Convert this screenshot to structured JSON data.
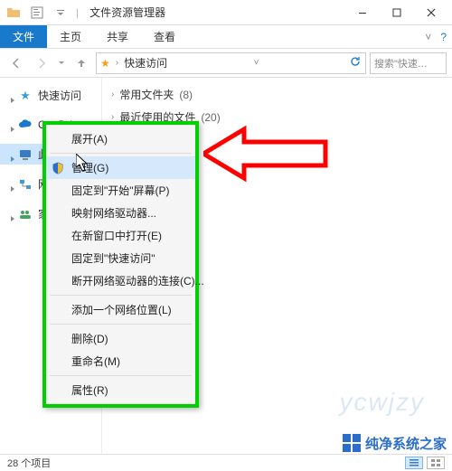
{
  "titlebar": {
    "appTitle": "文件资源管理器",
    "sep": "|"
  },
  "ribbon": {
    "file": "文件",
    "home": "主页",
    "share": "共享",
    "view": "查看",
    "help": "?"
  },
  "addrbar": {
    "crumb": "快速访问",
    "searchPlaceholder": "搜索\"快速…"
  },
  "sidebar": {
    "quickAccess": "快速访问",
    "onedrive": "OneDrive",
    "thisPC": "此电脑",
    "networkShort": "网",
    "homeShort": "家"
  },
  "content": {
    "frequentFolders": "常用文件夹",
    "frequentCount": "(8)",
    "recentFiles": "最近使用的文件",
    "recentCount": "(20)"
  },
  "contextMenu": {
    "expand": "展开(A)",
    "manage": "管理(G)",
    "pinStart": "固定到\"开始\"屏幕(P)",
    "mapDrive": "映射网络驱动器...",
    "openNew": "在新窗口中打开(E)",
    "pinQuick": "固定到\"快速访问\"",
    "disconnect": "断开网络驱动器的连接(C)...",
    "addNetLoc": "添加一个网络位置(L)",
    "delete": "删除(D)",
    "rename": "重命名(M)",
    "properties": "属性(R)"
  },
  "statusbar": {
    "items": "28 个项目"
  },
  "watermark": {
    "wm1": "ycwjzy",
    "wm2": "纯净系统之家"
  }
}
